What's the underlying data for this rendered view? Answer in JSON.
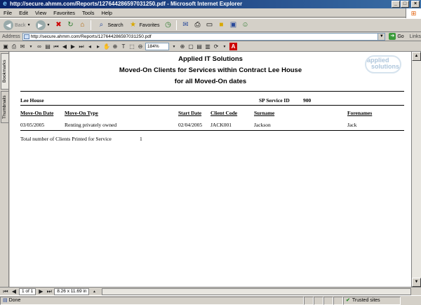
{
  "window": {
    "title": "http://secure.ahmm.com/Reports/127644286597031250.pdf - Microsoft Internet Explorer"
  },
  "menu": [
    "File",
    "Edit",
    "View",
    "Favorites",
    "Tools",
    "Help"
  ],
  "toolbar": {
    "back_label": "Back",
    "search_label": "Search",
    "favorites_label": "Favorites"
  },
  "address": {
    "label": "Address",
    "url": "http://secure.ahmm.com/Reports/127644286597031250.pdf",
    "go_label": "Go",
    "links_label": "Links"
  },
  "pdf_toolbar": {
    "zoom": "184%"
  },
  "side_tabs": {
    "bookmarks": "Bookmarks",
    "thumbnails": "Thumbnails"
  },
  "report": {
    "company": "Applied IT Solutions",
    "heading": "Moved-On Clients for Services within Contract Lee House",
    "subheading": "for all Moved-On dates",
    "logo_line1": "applied",
    "logo_line2": "solutions",
    "contract_name": "Lee House",
    "service_id_label": "SP Service ID",
    "service_id": "900",
    "columns": {
      "move_on_date": "Move-On Date",
      "move_on_type": "Move-On Type",
      "start_date": "Start Date",
      "client_code": "Client Code",
      "surname": "Surname",
      "forenames": "Forenames"
    },
    "rows": [
      {
        "move_on_date": "03/05/2005",
        "move_on_type": "Renting privately owned",
        "start_date": "02/04/2005",
        "client_code": "JACK001",
        "surname": "Jackson",
        "forenames": "Jack"
      }
    ],
    "total_label": "Total number of Clients Printed for Service",
    "total_value": "1"
  },
  "pdf_nav": {
    "page_info": "1 of 1",
    "page_size": "8.26 x 11.69 in"
  },
  "status": {
    "left": "Done",
    "zone": "Trusted sites"
  }
}
